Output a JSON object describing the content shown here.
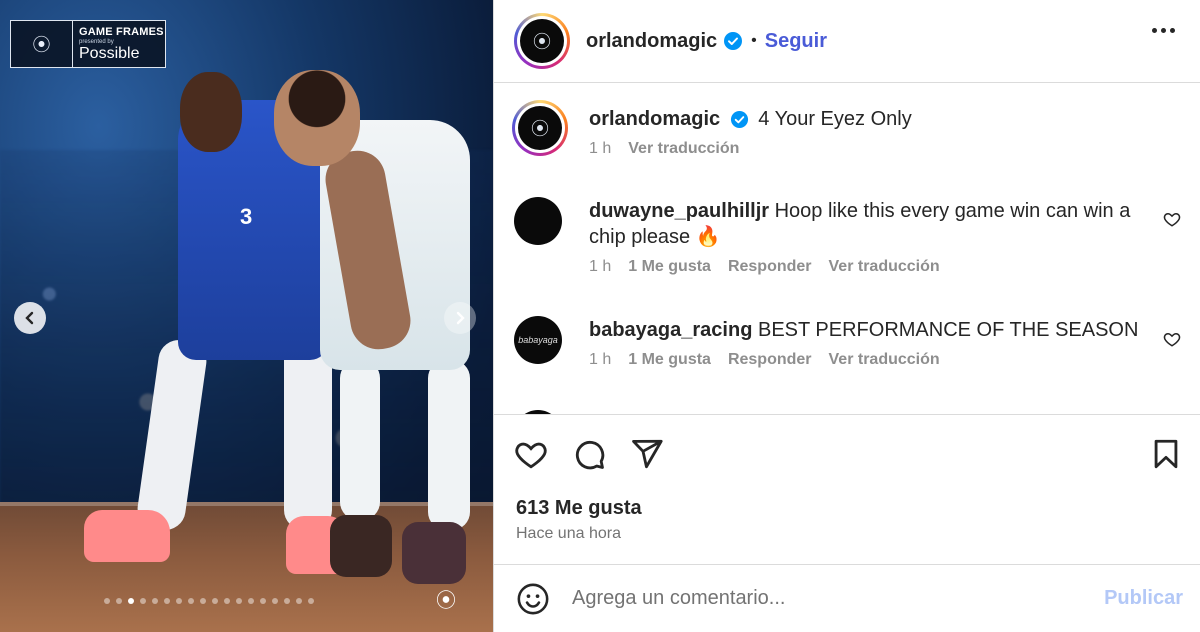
{
  "media": {
    "badge": {
      "line1": "GAME FRAMES",
      "line2": "presented by",
      "line3": "Possible"
    },
    "jersey_number": "3",
    "carousel": {
      "total": 18,
      "active_index": 2
    }
  },
  "header": {
    "username": "orlandomagic",
    "separator": "•",
    "follow_label": "Seguir"
  },
  "caption": {
    "username": "orlandomagic",
    "text": "4 Your Eyez Only",
    "time": "1 h",
    "translate": "Ver traducción"
  },
  "comments": [
    {
      "username": "duwayne_paulhilljr",
      "text": "Hoop like this every game win can win a chip please 🔥",
      "time": "1 h",
      "likes": "1 Me gusta",
      "reply": "Responder",
      "translate": "Ver traducción"
    },
    {
      "username": "babayaga_racing",
      "text": "BEST PERFORMANCE OF THE SEASON",
      "avatar_text": "babayaga",
      "time": "1 h",
      "likes": "1 Me gusta",
      "reply": "Responder",
      "translate": "Ver traducción"
    }
  ],
  "actions": {
    "likes": "613 Me gusta",
    "posted": "Hace una hora"
  },
  "compose": {
    "placeholder": "Agrega un comentario...",
    "publish_label": "Publicar"
  },
  "colors": {
    "link": "#4a5bd7",
    "publish_disabled": "#b3c8f7",
    "verified": "#0095f6"
  }
}
